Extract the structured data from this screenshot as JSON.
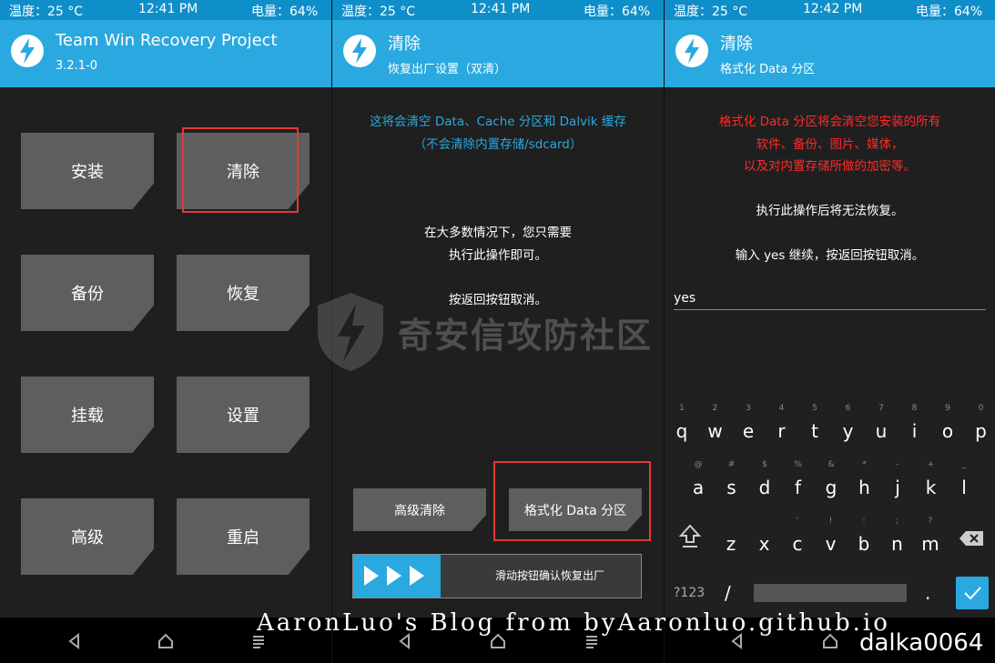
{
  "status": {
    "temp": "温度：25 °C",
    "battery": "电量：64%",
    "time1": "12:41 PM",
    "time2": "12:41 PM",
    "time3": "12:42 PM"
  },
  "panel1": {
    "title": "Team Win Recovery Project",
    "subtitle": "3.2.1-0",
    "tiles": [
      "安装",
      "清除",
      "备份",
      "恢复",
      "挂载",
      "设置",
      "高级",
      "重启"
    ]
  },
  "panel2": {
    "title": "清除",
    "subtitle": "恢复出厂设置（双清）",
    "info1": "这将会清空 Data、Cache 分区和 Dalvik 缓存",
    "info2": "（不会清除内置存储/sdcard）",
    "msg1": "在大多数情况下，您只需要",
    "msg2": "执行此操作即可。",
    "msg3": "按返回按钮取消。",
    "advanced_wipe": "高级清除",
    "format_data": "格式化 Data 分区",
    "swipe_label": "滑动按钮确认恢复出厂"
  },
  "panel3": {
    "title": "清除",
    "subtitle": "格式化 Data 分区",
    "warn1": "格式化 Data 分区将会清空您安装的所有",
    "warn2": "软件、备份、图片、媒体，",
    "warn3": "以及对内置存储所做的加密等。",
    "msg1": "执行此操作后将无法恢复。",
    "msg2": "输入 yes 继续，按返回按钮取消。",
    "input_value": "yes"
  },
  "keyboard": {
    "row1": [
      "q",
      "w",
      "e",
      "r",
      "t",
      "y",
      "u",
      "i",
      "o",
      "p"
    ],
    "row1_hints": [
      "1",
      "2",
      "3",
      "4",
      "5",
      "6",
      "7",
      "8",
      "9",
      "0"
    ],
    "row2": [
      "a",
      "s",
      "d",
      "f",
      "g",
      "h",
      "j",
      "k",
      "l"
    ],
    "row2_hints": [
      "@",
      "#",
      "$",
      "%",
      "&",
      "*",
      "-",
      "+",
      "_"
    ],
    "row3": [
      "z",
      "x",
      "c",
      "v",
      "b",
      "n",
      "m"
    ],
    "row3_hints": [
      "",
      "",
      "'",
      "!",
      ":",
      ";",
      "?"
    ],
    "sym": "?123",
    "slash": "/",
    "dot": "."
  },
  "watermark": "奇安信攻防社区",
  "footer_blog": "AaronLuo's Blog from byAaronluo.github.io",
  "footer_tag": "dalka0064",
  "colors": {
    "accent": "#2aa8e0",
    "highlight": "#e53935",
    "warning": "#ff2a2a"
  }
}
